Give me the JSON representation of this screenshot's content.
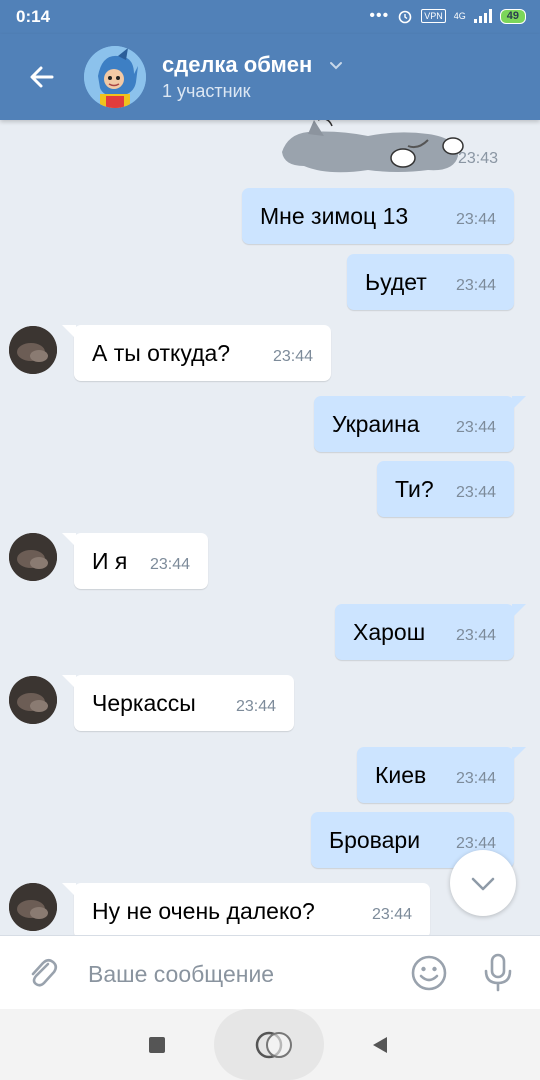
{
  "status": {
    "time": "0:14",
    "dots": "•••",
    "vpn": "VPN",
    "network": "4G",
    "battery": "49"
  },
  "header": {
    "title": "сделка обмен",
    "subtitle": "1 участник"
  },
  "sticker": {
    "time": "23:43"
  },
  "messages": [
    {
      "dir": "out",
      "text": "Мне зимоц 13",
      "time": "23:44"
    },
    {
      "dir": "out",
      "text": "Ьудет",
      "time": "23:44"
    },
    {
      "dir": "in",
      "text": "А ты откуда?",
      "time": "23:44"
    },
    {
      "dir": "out",
      "text": "Украина",
      "time": "23:44"
    },
    {
      "dir": "out",
      "text": "Ти?",
      "time": "23:44"
    },
    {
      "dir": "in",
      "text": "И я",
      "time": "23:44"
    },
    {
      "dir": "out",
      "text": "Харош",
      "time": "23:44"
    },
    {
      "dir": "in",
      "text": "Черкассы",
      "time": "23:44"
    },
    {
      "dir": "out",
      "text": "Киев",
      "time": "23:44"
    },
    {
      "dir": "out",
      "text": "Бровари",
      "time": "23:44"
    },
    {
      "dir": "in",
      "text": "Ну не очень далеко?",
      "time": "23:44"
    }
  ],
  "composer": {
    "placeholder": "Ваше сообщение",
    "value": ""
  },
  "icons": {
    "back": "arrow-left-icon",
    "chevron": "chevron-down-icon",
    "attach": "paperclip-icon",
    "emoji": "smiley-icon",
    "mic": "microphone-icon",
    "scroll": "chevron-down-icon"
  },
  "colors": {
    "header": "#5181b8",
    "outgoing_bubble": "#cce4ff",
    "incoming_bubble": "#ffffff",
    "background": "#e8edf3"
  }
}
